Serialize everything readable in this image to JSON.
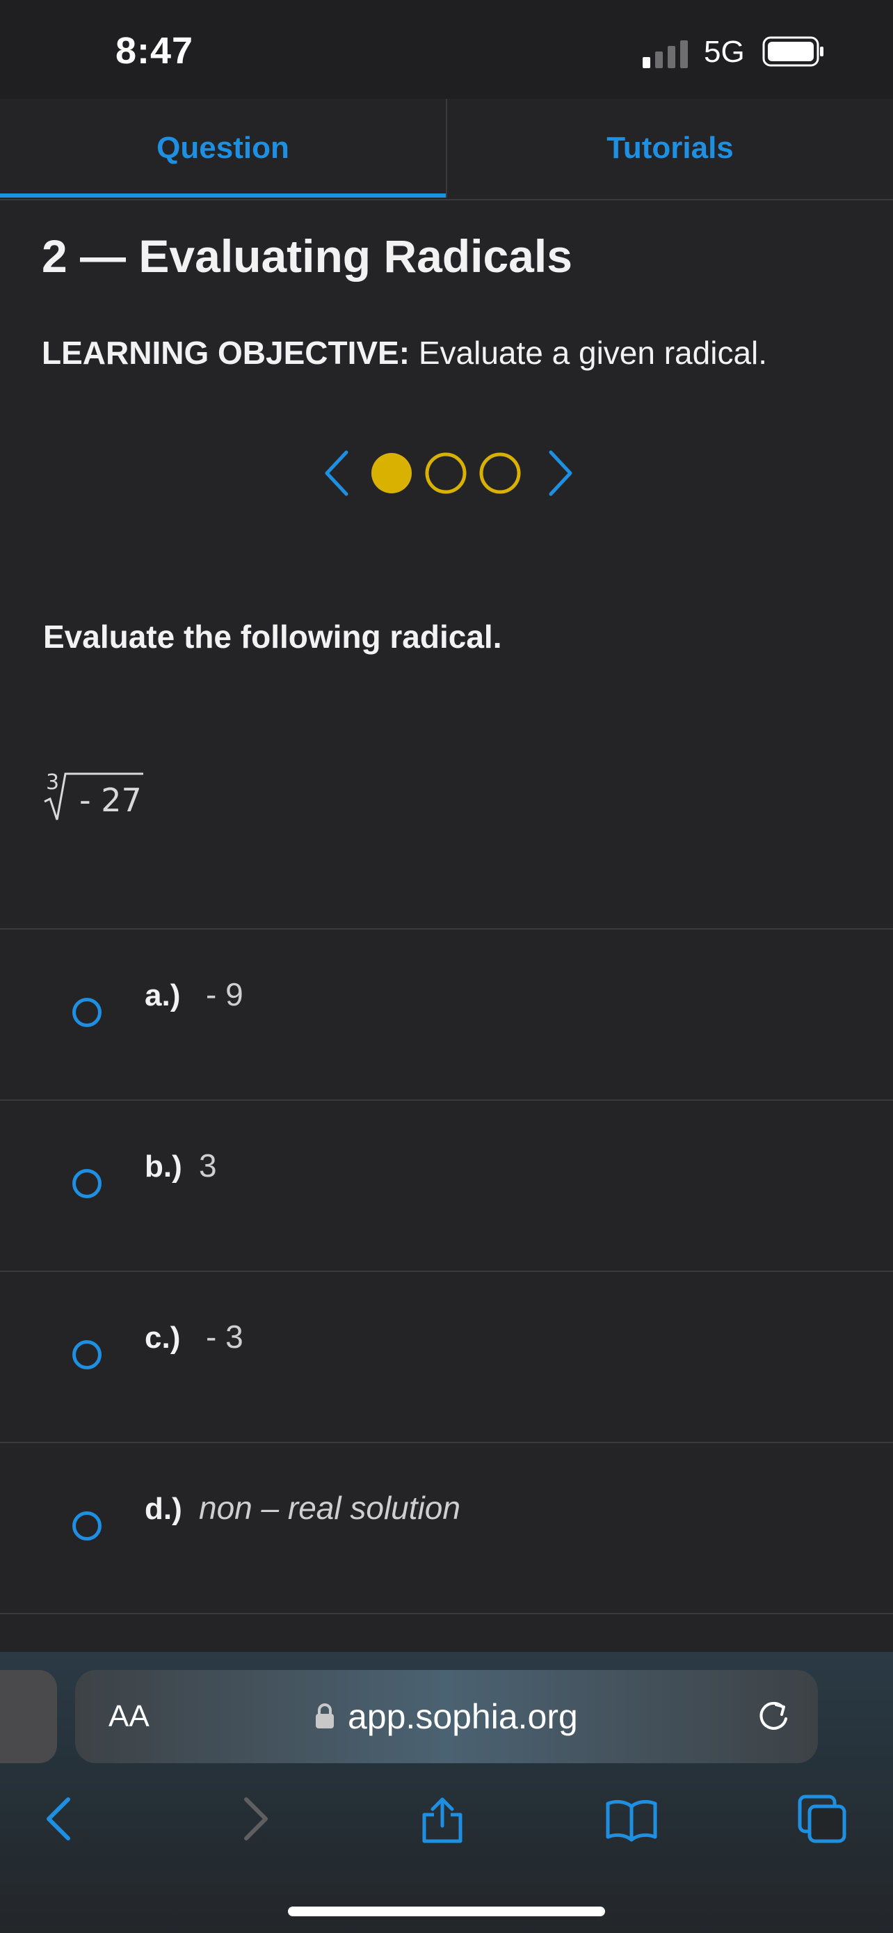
{
  "status": {
    "time": "8:47",
    "network": "5G"
  },
  "tabs": [
    {
      "label": "Question",
      "active": true
    },
    {
      "label": "Tutorials",
      "active": false
    }
  ],
  "page": {
    "title": "2 — Evaluating Radicals",
    "objective_label": "LEARNING OBJECTIVE:",
    "objective_text": "Evaluate a given radical."
  },
  "pager": {
    "total": 3,
    "current": 1
  },
  "question": {
    "prompt": "Evaluate the following radical.",
    "radical_index": "3",
    "radicand": "- 27"
  },
  "choices": [
    {
      "label": "a.)",
      "value": "- 9",
      "italic": false
    },
    {
      "label": "b.)",
      "value": "3",
      "italic": false
    },
    {
      "label": "c.)",
      "value": "- 3",
      "italic": false
    },
    {
      "label": "d.)",
      "value": "non – real solution",
      "italic": true
    }
  ],
  "browser": {
    "text_size_label": "AA",
    "url": "app.sophia.org"
  },
  "colors": {
    "accent": "#1e8fe1",
    "pager_gold": "#d9b100",
    "background": "#242426"
  }
}
